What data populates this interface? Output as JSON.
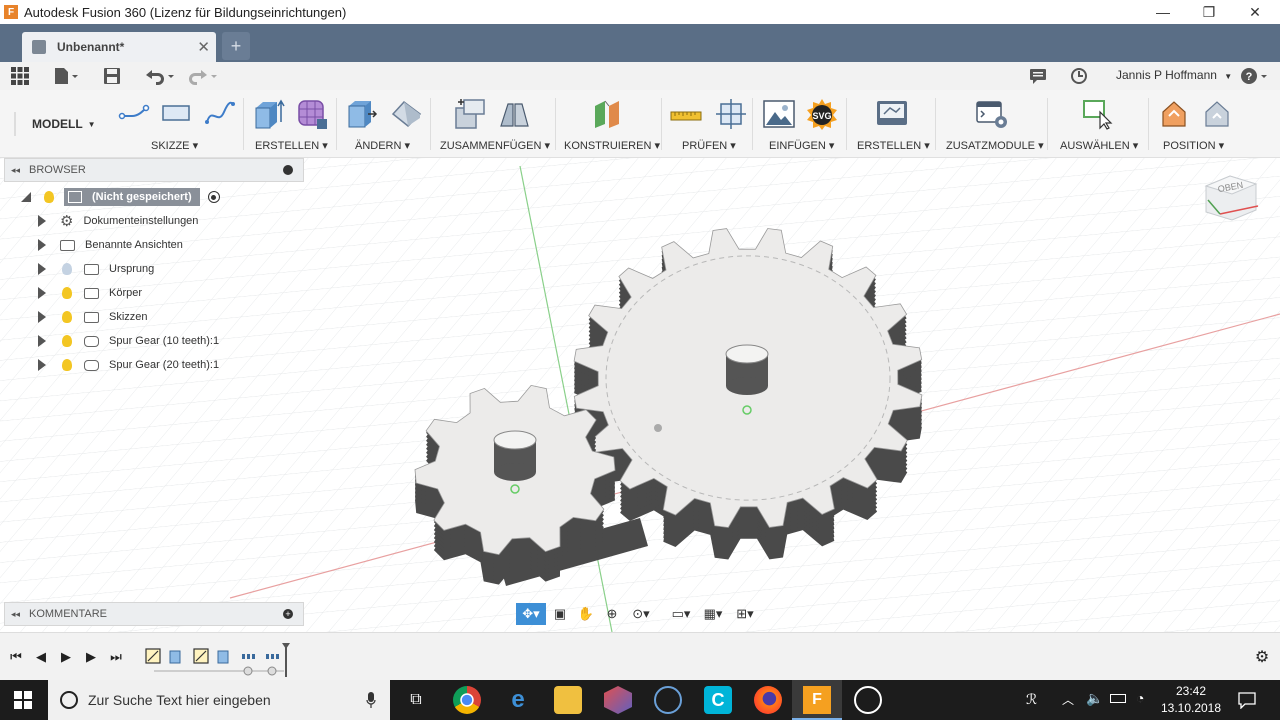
{
  "window": {
    "title": "Autodesk Fusion 360 (Lizenz für Bildungseinrichtungen)",
    "app_logo": "F",
    "controls": [
      "—",
      "❐",
      "✕"
    ]
  },
  "tabs": {
    "active_label": "Unbenannt*",
    "close_glyph": "✕",
    "new_tab_glyph": "+"
  },
  "quick_access": {
    "user": "Jannis P Hoffmann"
  },
  "ribbon": {
    "workspace": "MODELL",
    "groups": [
      {
        "label": "SKIZZE"
      },
      {
        "label": "ERSTELLEN"
      },
      {
        "label": "ÄNDERN"
      },
      {
        "label": "ZUSAMMENFÜGEN"
      },
      {
        "label": "KONSTRUIEREN"
      },
      {
        "label": "PRÜFEN"
      },
      {
        "label": "EINFÜGEN"
      },
      {
        "label": "ERSTELLEN"
      },
      {
        "label": "ZUSATZMODULE"
      },
      {
        "label": "AUSWÄHLEN"
      },
      {
        "label": "POSITION"
      }
    ],
    "svg_badge": "SVG"
  },
  "browser": {
    "title": "BROWSER",
    "root": "(Nicht gespeichert)",
    "items": [
      {
        "label": "Dokumenteinstellungen",
        "icon": "gear-icon"
      },
      {
        "label": "Benannte Ansichten",
        "icon": "folder-icon"
      },
      {
        "label": "Ursprung",
        "icon": "folder-icon",
        "bulb": "off"
      },
      {
        "label": "Körper",
        "icon": "folder-icon",
        "bulb": "on"
      },
      {
        "label": "Skizzen",
        "icon": "folder-icon",
        "bulb": "on"
      },
      {
        "label": "Spur Gear (10 teeth):1",
        "icon": "component-icon",
        "bulb": "on"
      },
      {
        "label": "Spur Gear (20 teeth):1",
        "icon": "component-icon",
        "bulb": "on"
      }
    ]
  },
  "comments": {
    "title": "KOMMENTARE"
  },
  "viewcube": {
    "face": "OBEN"
  },
  "taskbar": {
    "search_placeholder": "Zur Suche Text hier eingeben",
    "time": "23:42",
    "date": "13.10.2018"
  },
  "colors": {
    "tabbar": "#5a6e86",
    "ribbon": "#f5f5f5",
    "taskbar": "#1c1c1c",
    "gear_face": "#ecebea",
    "gear_side": "#4a4a4a"
  }
}
